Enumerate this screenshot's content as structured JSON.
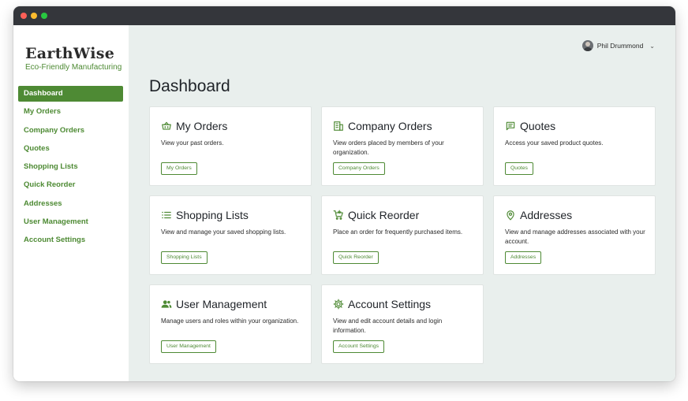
{
  "brand": {
    "name": "EarthWise",
    "tagline": "Eco-Friendly Manufacturing"
  },
  "nav": {
    "items": [
      {
        "label": "Dashboard",
        "active": true
      },
      {
        "label": "My Orders"
      },
      {
        "label": "Company Orders"
      },
      {
        "label": "Quotes"
      },
      {
        "label": "Shopping Lists"
      },
      {
        "label": "Quick Reorder"
      },
      {
        "label": "Addresses"
      },
      {
        "label": "User Management"
      },
      {
        "label": "Account Settings"
      }
    ]
  },
  "user": {
    "name": "Phil Drummond",
    "menu_icon": "chevron-down-icon"
  },
  "page": {
    "title": "Dashboard"
  },
  "cards": [
    {
      "title": "My Orders",
      "icon": "basket-icon",
      "description": "View your past orders.",
      "button": "My Orders"
    },
    {
      "title": "Company Orders",
      "icon": "building-icon",
      "description": "View orders placed by members of your organization.",
      "button": "Company Orders"
    },
    {
      "title": "Quotes",
      "icon": "message-icon",
      "description": "Access your saved product quotes.",
      "button": "Quotes"
    },
    {
      "title": "Shopping Lists",
      "icon": "list-icon",
      "description": "View and manage your saved shopping lists.",
      "button": "Shopping Lists"
    },
    {
      "title": "Quick Reorder",
      "icon": "cart-plus-icon",
      "description": "Place an order for frequently purchased items.",
      "button": "Quick Reorder"
    },
    {
      "title": "Addresses",
      "icon": "location-pin-icon",
      "description": "View and manage addresses associated with your account.",
      "button": "Addresses"
    },
    {
      "title": "User Management",
      "icon": "users-icon",
      "description": "Manage users and roles within your organization.",
      "button": "User Management"
    },
    {
      "title": "Account Settings",
      "icon": "gear-icon",
      "description": "View and edit account details and login information.",
      "button": "Account Settings"
    }
  ],
  "colors": {
    "brand_green": "#4e8a34",
    "main_background": "#e9efed",
    "titlebar": "#34363b"
  }
}
